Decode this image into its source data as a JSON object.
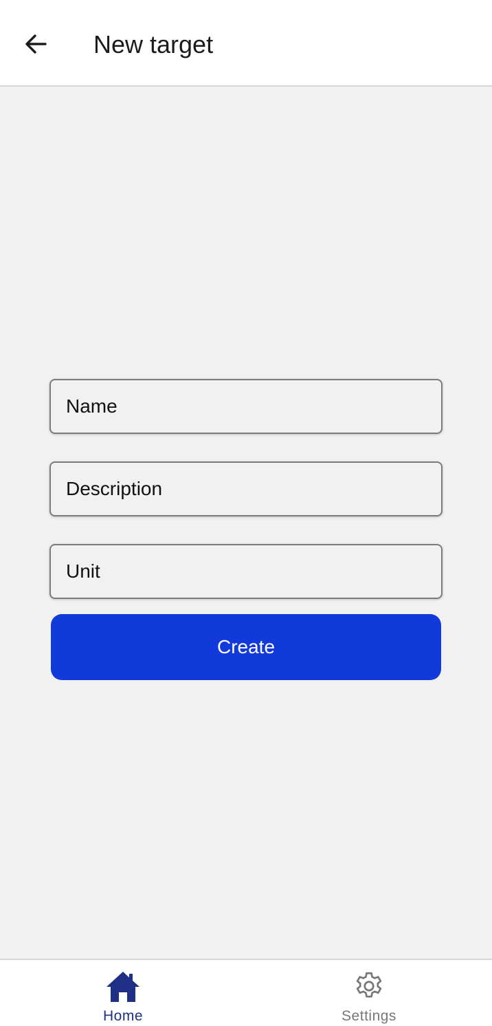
{
  "header": {
    "back_icon": "arrow-left-icon",
    "title": "New target"
  },
  "form": {
    "name": {
      "placeholder": "Name",
      "value": ""
    },
    "description": {
      "placeholder": "Description",
      "value": ""
    },
    "unit": {
      "placeholder": "Unit",
      "value": ""
    },
    "create_label": "Create"
  },
  "bottom_nav": {
    "items": [
      {
        "label": "Home",
        "icon": "home-icon",
        "active": true,
        "color": "#1f2f86"
      },
      {
        "label": "Settings",
        "icon": "gear-icon",
        "active": false,
        "color": "#777777"
      }
    ]
  },
  "colors": {
    "accent": "#123adb",
    "nav_active": "#1f2f86",
    "nav_inactive": "#777777",
    "background": "#f1f1f2"
  }
}
